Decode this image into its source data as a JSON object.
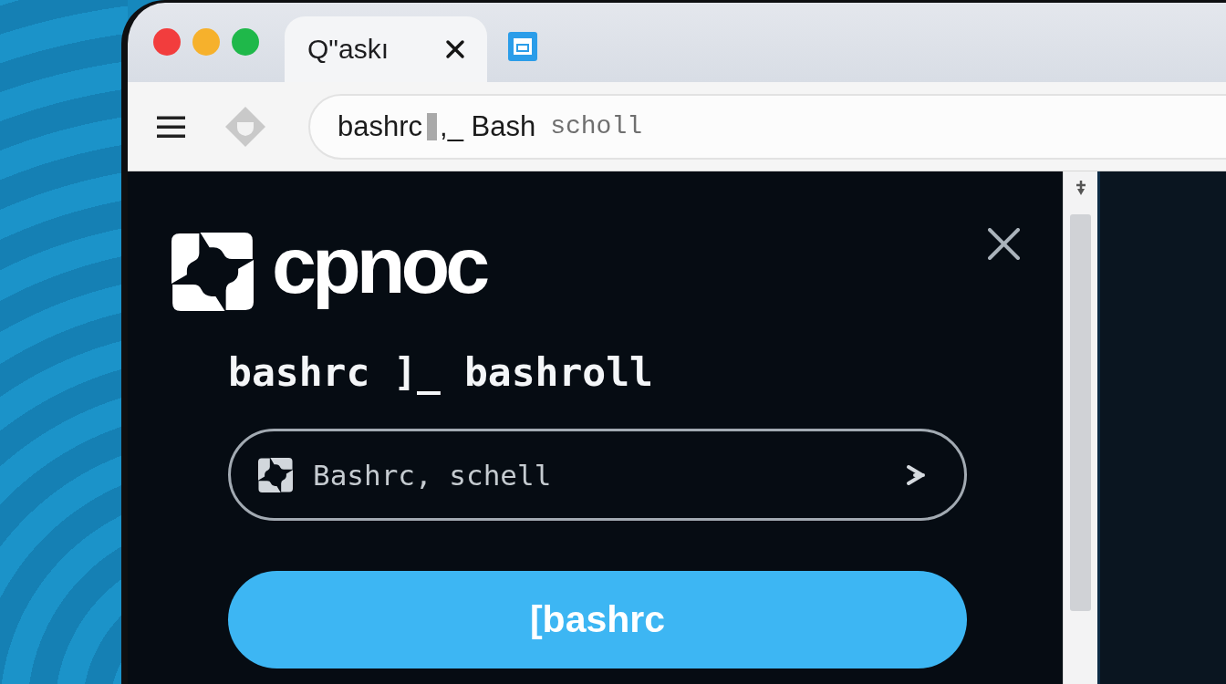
{
  "window": {
    "traffic_lights": [
      {
        "color": "#f23d3d"
      },
      {
        "color": "#f6b12c"
      },
      {
        "color": "#1fb84a"
      }
    ]
  },
  "tabs": [
    {
      "title": "Q\"askı",
      "selected": true
    }
  ],
  "address_bar": {
    "text": "bashrc",
    "text_after_cursor": ",_ Bash",
    "suggestion": "scholl"
  },
  "panel": {
    "logo_text": "cpnoc",
    "heading": "bashrc ]_ bashroll",
    "search": {
      "placeholder": "Bashrc, schell"
    },
    "button": "[bashrc"
  }
}
